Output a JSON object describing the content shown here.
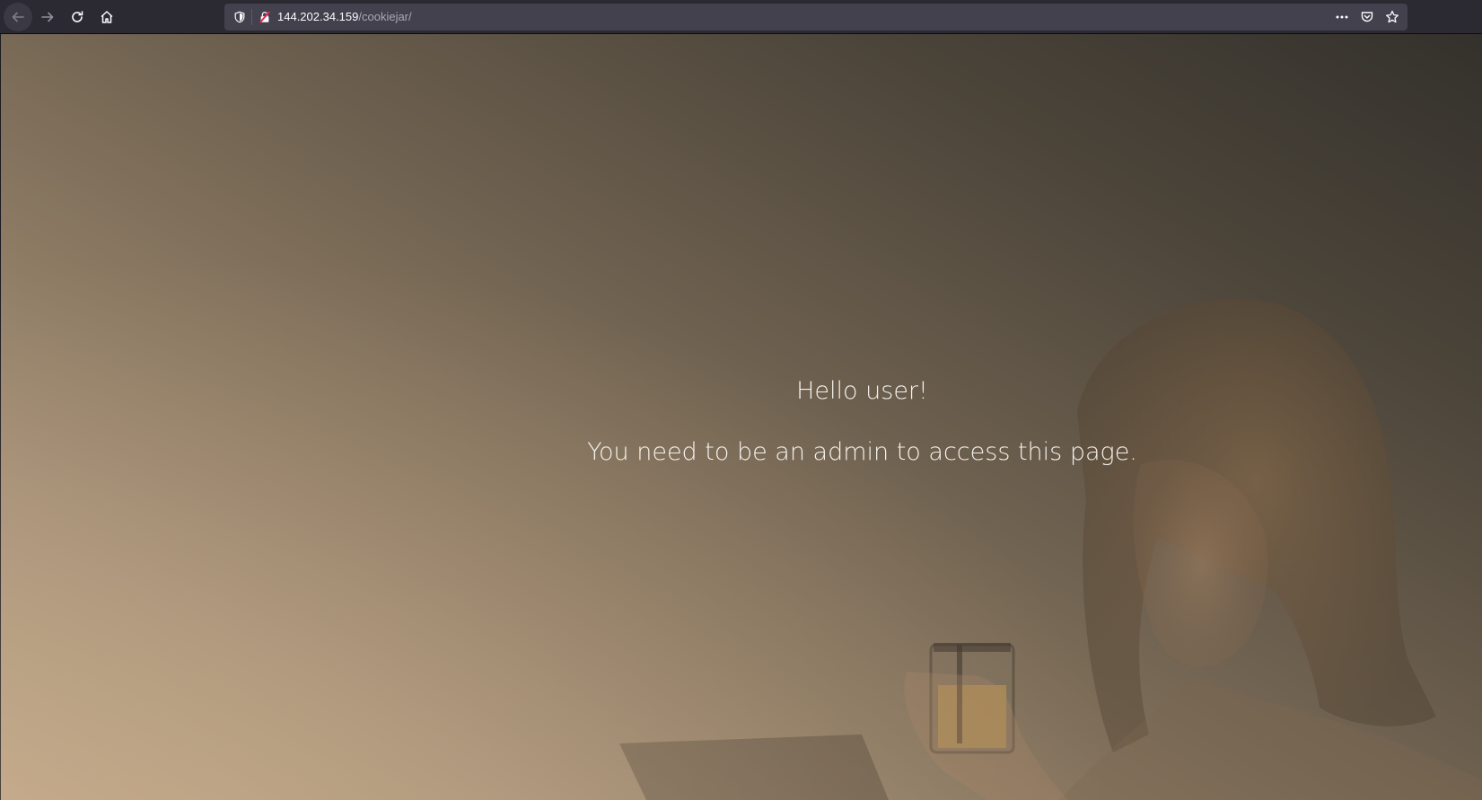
{
  "browser": {
    "url_host": "144.202.34.159",
    "url_path": "/cookiejar/",
    "icons": {
      "back": "back-arrow-icon",
      "forward": "forward-arrow-icon",
      "reload": "reload-icon",
      "home": "home-icon",
      "tracking": "tracking-protection-shield-icon",
      "insecure": "insecure-connection-lock-icon",
      "menu": "page-actions-ellipsis-icon",
      "pocket": "pocket-icon",
      "bookmark": "bookmark-star-icon"
    }
  },
  "page": {
    "greeting": "Hello user!",
    "message": "You need to be an admin to access this page."
  },
  "colors": {
    "toolbar": "#2b2a33",
    "urlbar": "#42414d",
    "text": "#f4f1ec"
  }
}
